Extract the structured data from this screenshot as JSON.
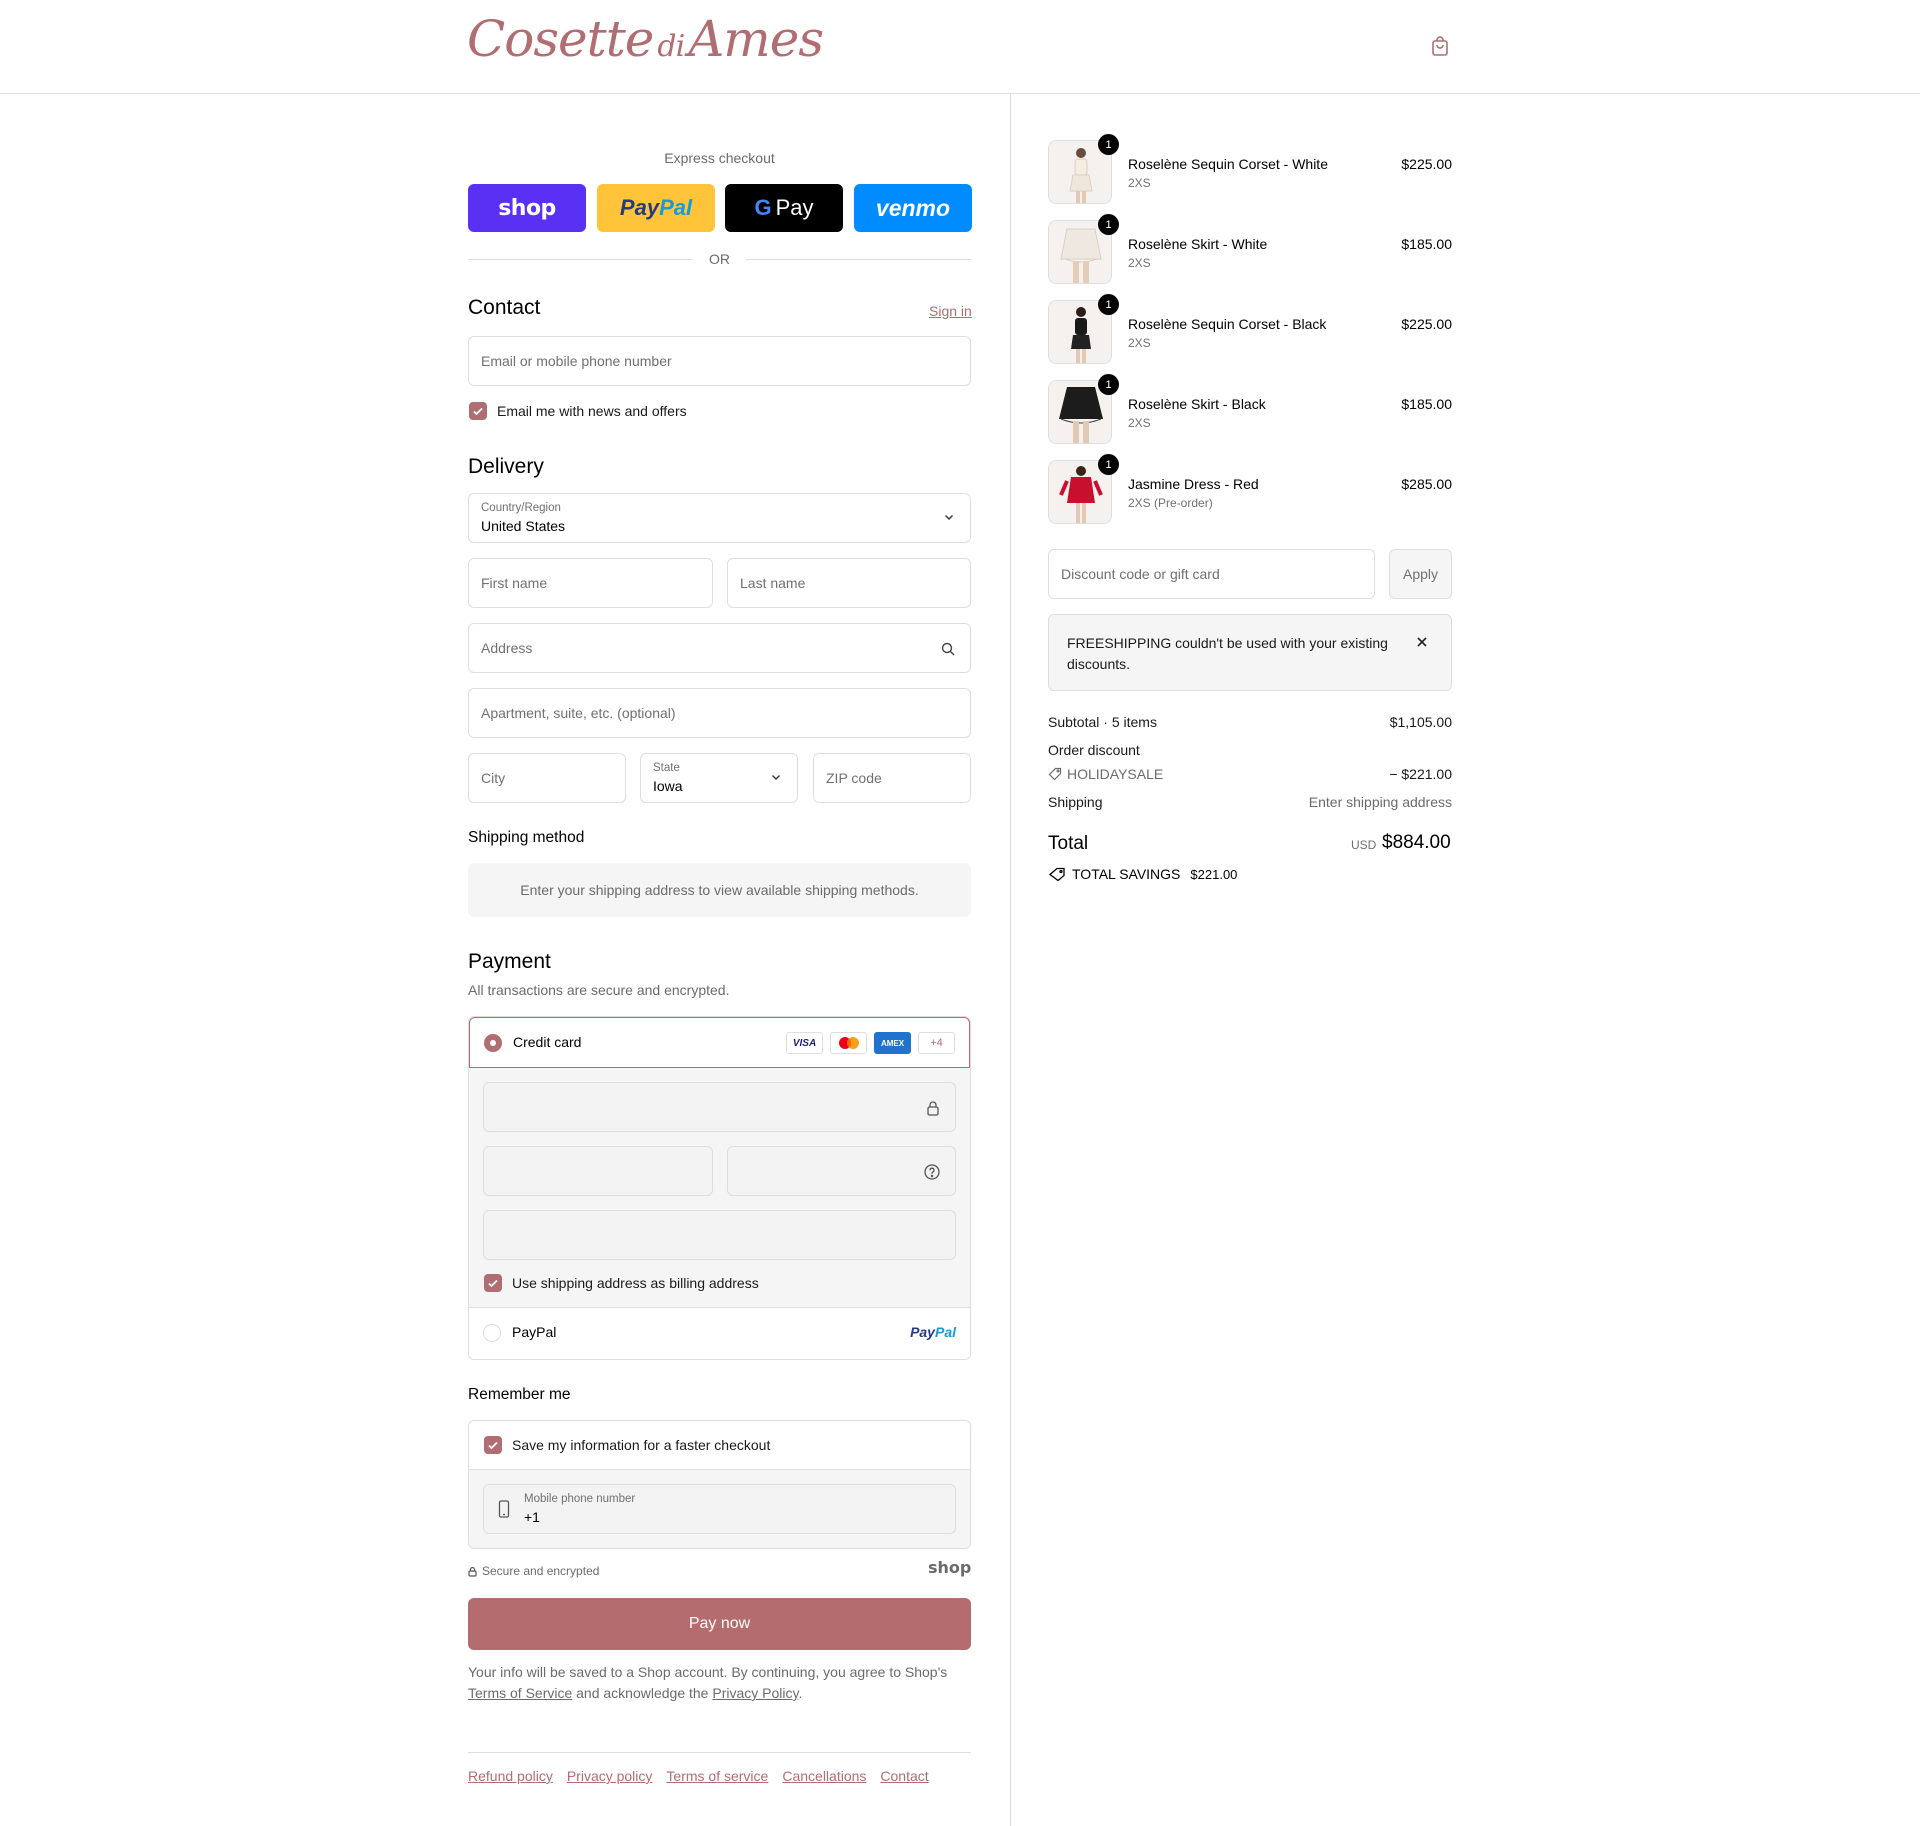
{
  "brand": {
    "logo_main1": "Cosette",
    "logo_di": "di",
    "logo_main2": "Ames",
    "accent": "#b06d72"
  },
  "header": {
    "cart_icon": "shopping-bag-icon"
  },
  "express": {
    "title": "Express checkout",
    "shop_label": "shop",
    "paypal_pay": "Pay",
    "paypal_pal": "Pal",
    "gpay_g": "G",
    "gpay_label": "Pay",
    "venmo_label": "venmo",
    "or_label": "OR"
  },
  "contact": {
    "title": "Contact",
    "sign_in": "Sign in",
    "email_placeholder": "Email or mobile phone number",
    "news_label": "Email me with news and offers",
    "news_checked": true
  },
  "delivery": {
    "title": "Delivery",
    "country_label": "Country/Region",
    "country_value": "United States",
    "first_name": "First name",
    "last_name": "Last name",
    "address": "Address",
    "apartment": "Apartment, suite, etc. (optional)",
    "city": "City",
    "state_label": "State",
    "state_value": "Iowa",
    "zip": "ZIP code"
  },
  "shipping_method": {
    "title": "Shipping method",
    "message": "Enter your shipping address to view available shipping methods."
  },
  "payment": {
    "title": "Payment",
    "subtitle": "All transactions are secure and encrypted.",
    "credit_card_label": "Credit card",
    "card_logos": [
      "VISA",
      "",
      "AMEX",
      "+4"
    ],
    "billing_label": "Use shipping address as billing address",
    "billing_checked": true,
    "paypal_label": "PayPal",
    "paypal_logo_pay": "Pay",
    "paypal_logo_pal": "Pal"
  },
  "remember": {
    "title": "Remember me",
    "save_label": "Save my information for a faster checkout",
    "save_checked": true,
    "phone_label": "Mobile phone number",
    "phone_value": "+1"
  },
  "secure": {
    "label": "Secure and encrypted",
    "shop_logo": "shop"
  },
  "pay_now": "Pay now",
  "legal": {
    "text1": "Your info will be saved to a Shop account. By continuing, you agree to Shop's ",
    "terms": "Terms of Service",
    "text2": " and acknowledge the ",
    "privacy": "Privacy Policy",
    "text3": "."
  },
  "footer": {
    "links": [
      "Refund policy",
      "Privacy policy",
      "Terms of service",
      "Cancellations",
      "Contact"
    ]
  },
  "cart": {
    "items": [
      {
        "name": "Roselène Sequin Corset - White",
        "variant": "2XS",
        "price": "$225.00",
        "qty": "1"
      },
      {
        "name": "Roselène Skirt - White",
        "variant": "2XS",
        "price": "$185.00",
        "qty": "1"
      },
      {
        "name": "Roselène Sequin Corset - Black",
        "variant": "2XS",
        "price": "$225.00",
        "qty": "1"
      },
      {
        "name": "Roselène Skirt - Black",
        "variant": "2XS",
        "price": "$185.00",
        "qty": "1"
      },
      {
        "name": "Jasmine Dress - Red",
        "variant": "2XS (Pre-order)",
        "price": "$285.00",
        "qty": "1"
      }
    ],
    "discount_placeholder": "Discount code or gift card",
    "apply_label": "Apply",
    "notice": "FREESHIPPING couldn't be used with your existing discounts."
  },
  "summary": {
    "subtotal_label": "Subtotal · 5 items",
    "subtotal_value": "$1,105.00",
    "order_discount_label": "Order discount",
    "discount_code": "HOLIDAYSALE",
    "discount_value": "− $221.00",
    "shipping_label": "Shipping",
    "shipping_value": "Enter shipping address",
    "total_label": "Total",
    "currency": "USD",
    "total_value": "$884.00",
    "savings_label": "TOTAL SAVINGS",
    "savings_value": "$221.00"
  }
}
